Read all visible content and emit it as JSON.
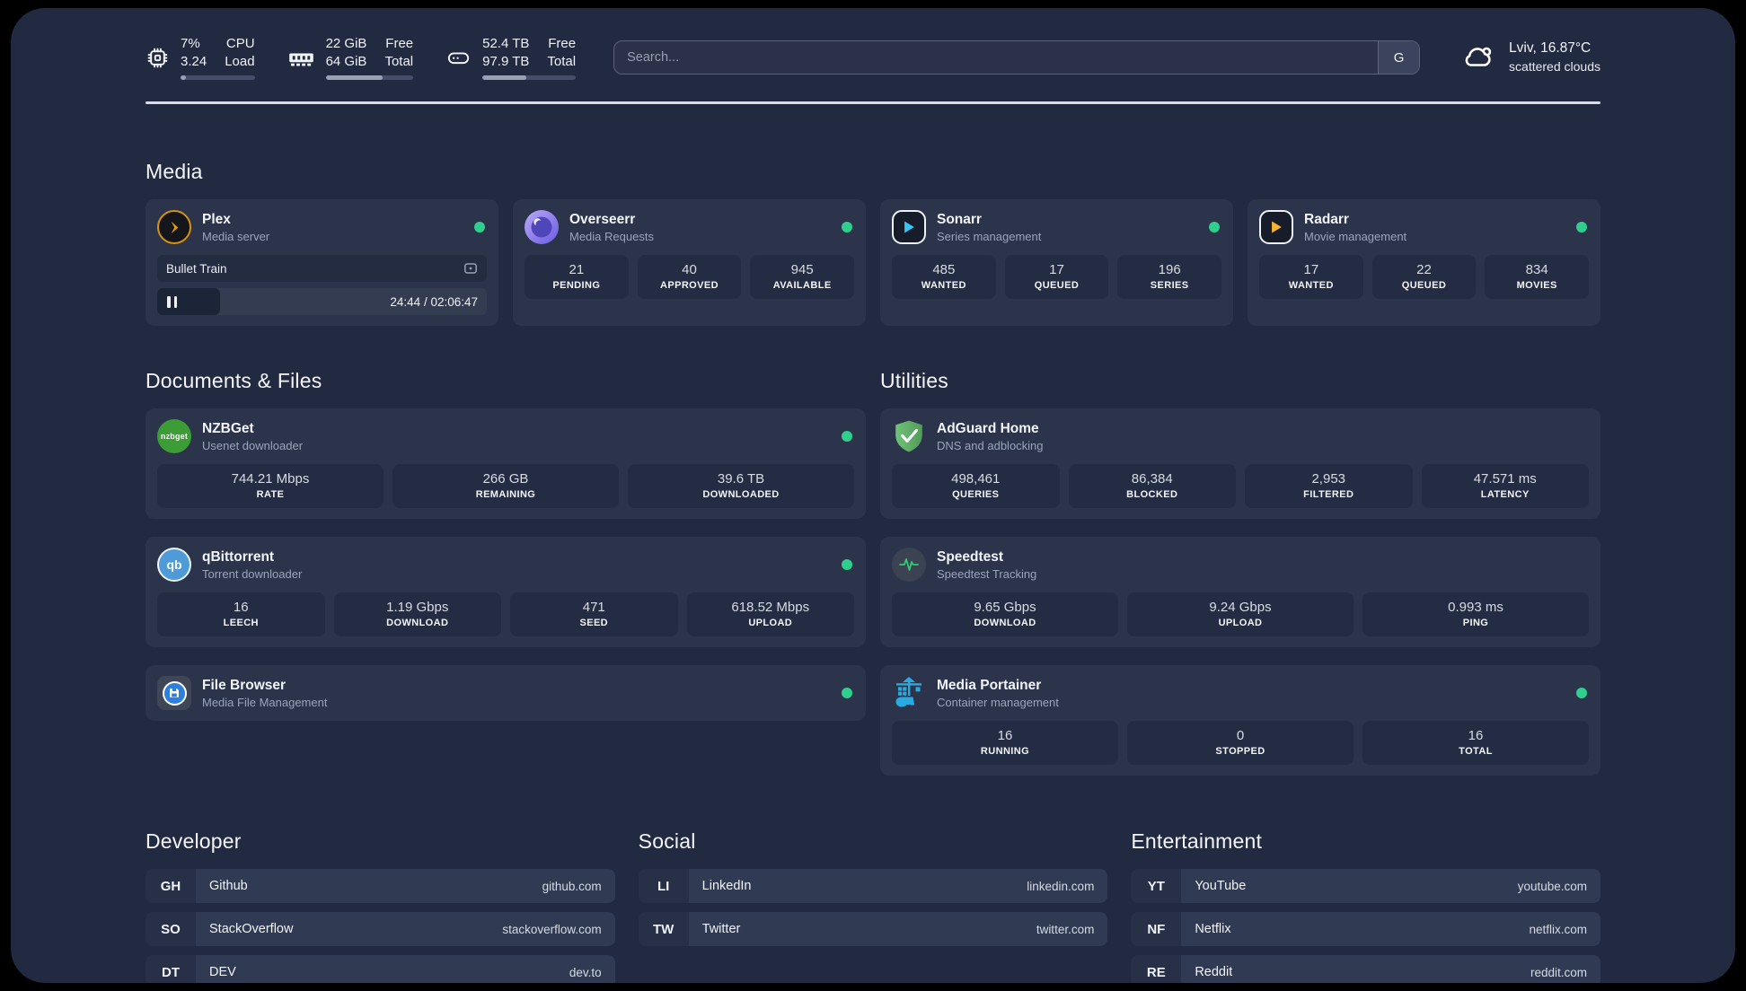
{
  "topbar": {
    "widgets": [
      {
        "icon": "cpu-icon",
        "v1": "7%",
        "v2": "3.24",
        "l1": "CPU",
        "l2": "Load",
        "progress_pct": 7
      },
      {
        "icon": "ram-icon",
        "v1": "22 GiB",
        "v2": "64 GiB",
        "l1": "Free",
        "l2": "Total",
        "progress_pct": 65
      },
      {
        "icon": "disk-icon",
        "v1": "52.4 TB",
        "v2": "97.9 TB",
        "l1": "Free",
        "l2": "Total",
        "progress_pct": 47
      }
    ],
    "search": {
      "placeholder": "Search...",
      "provider_button": "G"
    },
    "weather": {
      "icon": "cloud-icon",
      "location": "Lviv, 16.87°C",
      "condition": "scattered clouds"
    }
  },
  "sections": {
    "media": {
      "heading": "Media",
      "plex": {
        "name": "Plex",
        "desc": "Media server",
        "online": true,
        "player": {
          "title": "Bullet Train",
          "time": "24:44 / 02:06:47",
          "progress_pct": 19
        }
      },
      "overseerr": {
        "name": "Overseerr",
        "desc": "Media Requests",
        "online": true,
        "stats": [
          {
            "value": "21",
            "label": "PENDING"
          },
          {
            "value": "40",
            "label": "APPROVED"
          },
          {
            "value": "945",
            "label": "AVAILABLE"
          }
        ]
      },
      "sonarr": {
        "name": "Sonarr",
        "desc": "Series management",
        "online": true,
        "stats": [
          {
            "value": "485",
            "label": "WANTED"
          },
          {
            "value": "17",
            "label": "QUEUED"
          },
          {
            "value": "196",
            "label": "SERIES"
          }
        ]
      },
      "radarr": {
        "name": "Radarr",
        "desc": "Movie management",
        "online": true,
        "stats": [
          {
            "value": "17",
            "label": "WANTED"
          },
          {
            "value": "22",
            "label": "QUEUED"
          },
          {
            "value": "834",
            "label": "MOVIES"
          }
        ]
      }
    },
    "documents": {
      "heading": "Documents & Files",
      "nzbget": {
        "name": "NZBGet",
        "desc": "Usenet downloader",
        "online": true,
        "logo_text": "nzbget",
        "stats": [
          {
            "value": "744.21 Mbps",
            "label": "RATE"
          },
          {
            "value": "266 GB",
            "label": "REMAINING"
          },
          {
            "value": "39.6 TB",
            "label": "DOWNLOADED"
          }
        ]
      },
      "qbittorrent": {
        "name": "qBittorrent",
        "desc": "Torrent downloader",
        "online": true,
        "logo_text": "qb",
        "stats": [
          {
            "value": "16",
            "label": "LEECH"
          },
          {
            "value": "1.19 Gbps",
            "label": "DOWNLOAD"
          },
          {
            "value": "471",
            "label": "SEED"
          },
          {
            "value": "618.52 Mbps",
            "label": "UPLOAD"
          }
        ]
      },
      "filebrowser": {
        "name": "File Browser",
        "desc": "Media File Management",
        "online": true
      }
    },
    "utilities": {
      "heading": "Utilities",
      "adguard": {
        "name": "AdGuard Home",
        "desc": "DNS and adblocking",
        "stats": [
          {
            "value": "498,461",
            "label": "QUERIES"
          },
          {
            "value": "86,384",
            "label": "BLOCKED"
          },
          {
            "value": "2,953",
            "label": "FILTERED"
          },
          {
            "value": "47.571 ms",
            "label": "LATENCY"
          }
        ]
      },
      "speedtest": {
        "name": "Speedtest",
        "desc": "Speedtest Tracking",
        "stats": [
          {
            "value": "9.65 Gbps",
            "label": "DOWNLOAD"
          },
          {
            "value": "9.24 Gbps",
            "label": "UPLOAD"
          },
          {
            "value": "0.993 ms",
            "label": "PING"
          }
        ]
      },
      "portainer": {
        "name": "Media Portainer",
        "desc": "Container management",
        "online": true,
        "stats": [
          {
            "value": "16",
            "label": "RUNNING"
          },
          {
            "value": "0",
            "label": "STOPPED"
          },
          {
            "value": "16",
            "label": "TOTAL"
          }
        ]
      }
    },
    "bookmarks": {
      "developer": {
        "heading": "Developer",
        "links": [
          {
            "abbr": "GH",
            "name": "Github",
            "url": "github.com"
          },
          {
            "abbr": "SO",
            "name": "StackOverflow",
            "url": "stackoverflow.com"
          },
          {
            "abbr": "DT",
            "name": "DEV",
            "url": "dev.to"
          }
        ]
      },
      "social": {
        "heading": "Social",
        "links": [
          {
            "abbr": "LI",
            "name": "LinkedIn",
            "url": "linkedin.com"
          },
          {
            "abbr": "TW",
            "name": "Twitter",
            "url": "twitter.com"
          }
        ]
      },
      "entertainment": {
        "heading": "Entertainment",
        "links": [
          {
            "abbr": "YT",
            "name": "YouTube",
            "url": "youtube.com"
          },
          {
            "abbr": "NF",
            "name": "Netflix",
            "url": "netflix.com"
          },
          {
            "abbr": "RE",
            "name": "Reddit",
            "url": "reddit.com"
          }
        ]
      }
    }
  },
  "colors": {
    "page_bg": "#222a41",
    "card_bg": "#2b344b",
    "stat_bg": "#232c42",
    "status_online_green": "#2fd08d",
    "plex_orange": "#e5a00d",
    "sonarr_cyan": "#35c5f4",
    "radarr_yellow": "#f7b32a",
    "nzbget_green": "#3c9c35",
    "qbittorrent_blue": "#4e9bd8",
    "adguard_green": "#67bc71",
    "speedtest_green": "#2ecc71",
    "portainer_blue": "#29aae1",
    "filebrowser_blue": "#2f80dd"
  }
}
